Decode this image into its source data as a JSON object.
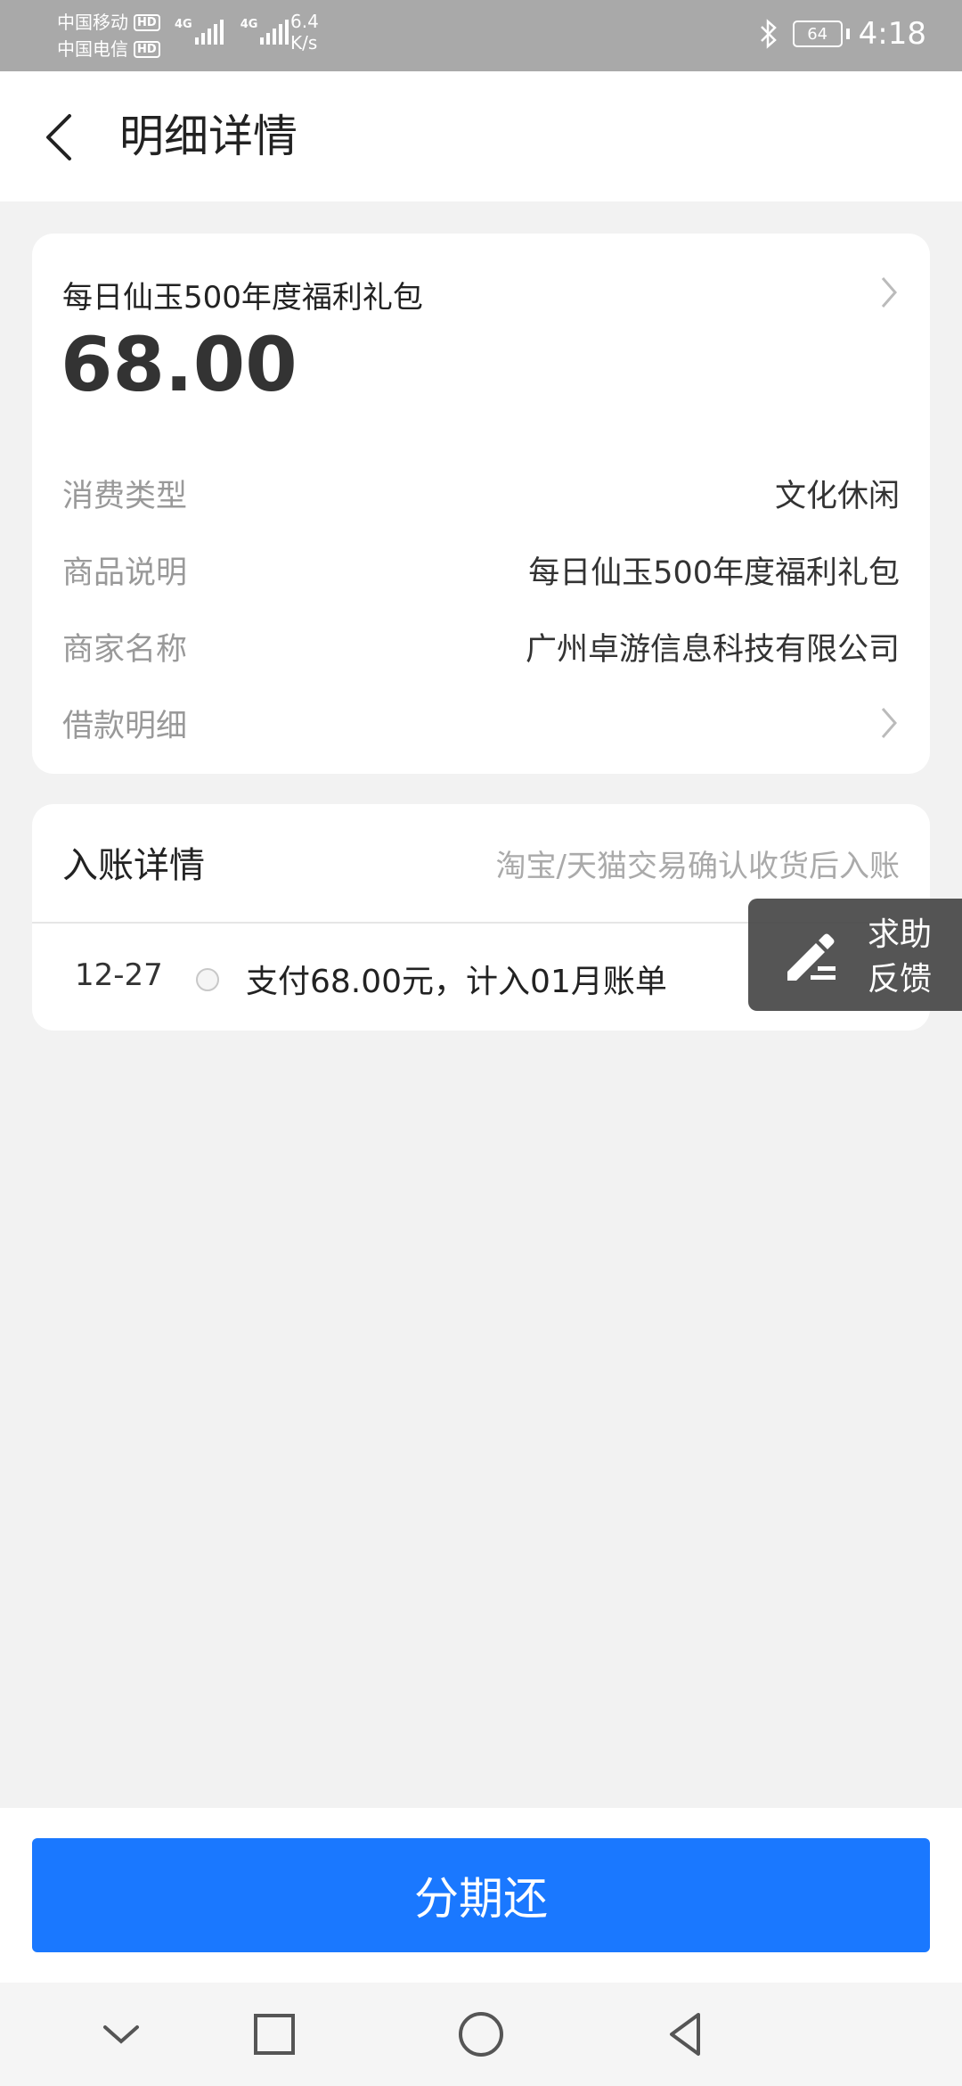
{
  "status_bar": {
    "carrier1": "中国移动",
    "carrier2": "中国电信",
    "hd": "HD",
    "net1": "4G",
    "net2": "4G",
    "speed_value": "6.4",
    "speed_unit": "K/s",
    "battery": "64",
    "time": "4:18",
    "bluetooth_icon": "bluetooth-icon"
  },
  "header": {
    "title": "明细详情",
    "back_icon": "back-arrow-icon"
  },
  "detail": {
    "product_name": "每日仙玉500年度福利礼包",
    "amount": "68.00",
    "rows": [
      {
        "label": "消费类型",
        "value": "文化休闲"
      },
      {
        "label": "商品说明",
        "value": "每日仙玉500年度福利礼包"
      },
      {
        "label": "商家名称",
        "value": "广州卓游信息科技有限公司"
      },
      {
        "label": "借款明细",
        "value": ""
      }
    ]
  },
  "entry": {
    "title": "入账详情",
    "note": "淘宝/天猫交易确认收货后入账",
    "date": "12-27",
    "text": "支付68.00元，计入01月账单"
  },
  "feedback": {
    "line1": "求助",
    "line2": "反馈",
    "icon": "pen-icon"
  },
  "action": {
    "button_label": "分期还"
  },
  "nav": {
    "icons": [
      "chevron-down-icon",
      "square-icon",
      "circle-icon",
      "triangle-back-icon"
    ]
  },
  "colors": {
    "primary": "#1a78ff",
    "status_bar": "#a9a9a9",
    "background": "#f2f2f2"
  }
}
